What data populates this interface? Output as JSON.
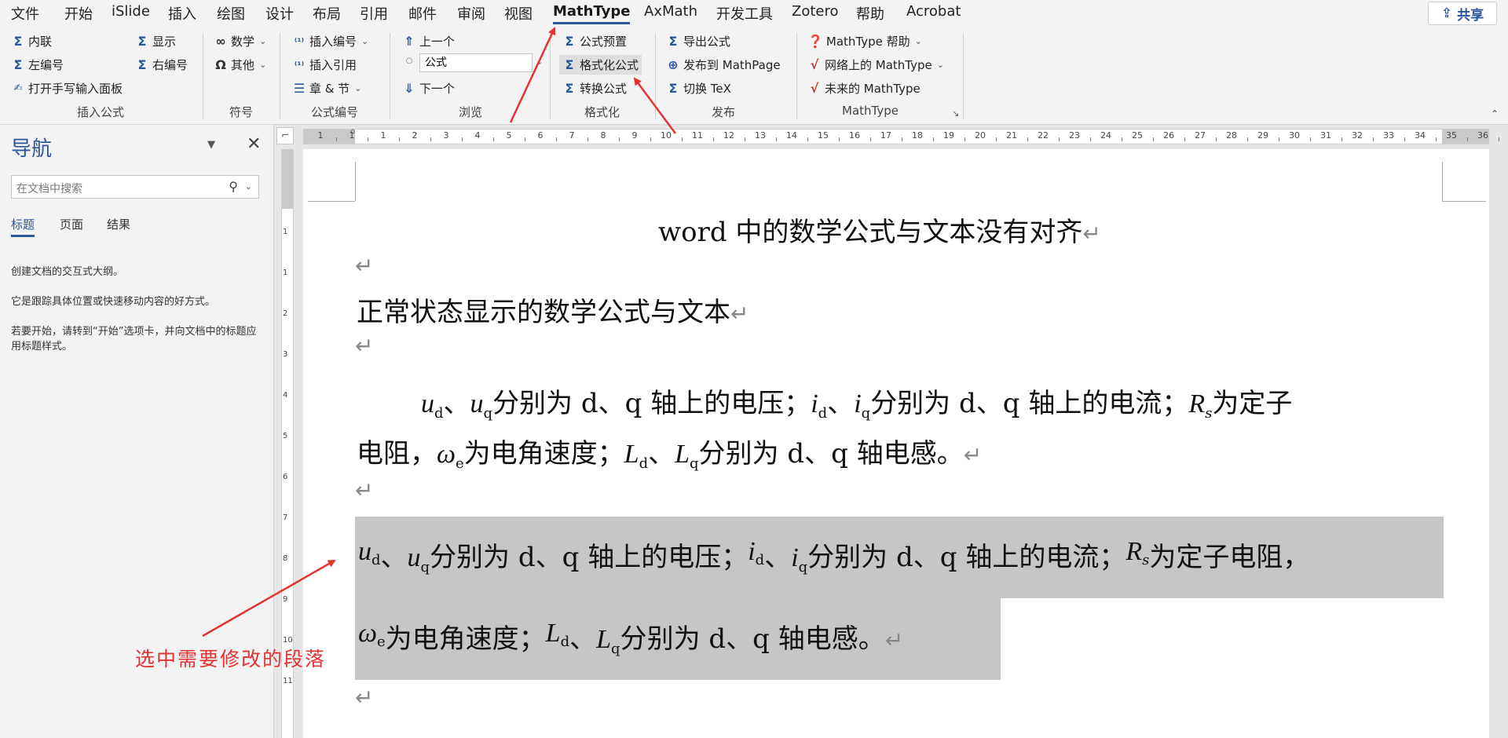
{
  "tabs": [
    "文件",
    "开始",
    "iSlide",
    "插入",
    "绘图",
    "设计",
    "布局",
    "引用",
    "邮件",
    "审阅",
    "视图",
    "MathType",
    "AxMath",
    "开发工具",
    "Zotero",
    "帮助",
    "Acrobat"
  ],
  "active_tab": "MathType",
  "share_label": "共享",
  "ribbon": {
    "insert_formula": {
      "inline": "内联",
      "display": "显示",
      "left_number": "左编号",
      "right_number": "右编号",
      "handwrite": "打开手写输入面板",
      "label": "插入公式"
    },
    "symbols": {
      "math": "数学",
      "other": "其他",
      "label": "符号"
    },
    "numbering": {
      "insert_number": "插入编号",
      "insert_ref": "插入引用",
      "chapter": "章 & 节",
      "label": "公式编号"
    },
    "browse": {
      "prev": "上一个",
      "next": "下一个",
      "field_value": "公式",
      "label": "浏览"
    },
    "format": {
      "preset": "公式预置",
      "format_eq": "格式化公式",
      "convert": "转换公式",
      "label": "格式化"
    },
    "publish": {
      "export": "导出公式",
      "mathpage": "发布到 MathPage",
      "toggle_tex": "切换 TeX",
      "label": "发布"
    },
    "mathtype": {
      "help": "MathType 帮助",
      "online": "网络上的 MathType",
      "future": "未来的 MathType",
      "label": "MathType"
    }
  },
  "nav": {
    "title": "导航",
    "search_placeholder": "在文档中搜索",
    "tabs": [
      "标题",
      "页面",
      "结果"
    ],
    "hint1": "创建文档的交互式大纲。",
    "hint2": "它是跟踪具体位置或快速移动内容的好方式。",
    "hint3": "若要开始，请转到“开始”选项卡，并向文档中的标题应用标题样式。"
  },
  "ruler": {
    "h_numbers": [
      "1",
      "1",
      "1",
      "2",
      "3",
      "4",
      "5",
      "6",
      "7",
      "8",
      "9",
      "10",
      "11",
      "12",
      "13",
      "14",
      "15",
      "16",
      "17",
      "18",
      "19",
      "20",
      "21",
      "22",
      "23",
      "24",
      "25",
      "26",
      "27",
      "28",
      "29",
      "30",
      "31",
      "32",
      "33",
      "34",
      "35",
      "36"
    ],
    "v_numbers": [
      "1",
      "1",
      "2",
      "3",
      "4",
      "5",
      "6",
      "7",
      "8",
      "9",
      "10",
      "11"
    ]
  },
  "document": {
    "title": "word 中的数学公式与文本没有对齐",
    "heading": "正常状态显示的数学公式与文本",
    "para_a": "分别为 d、q 轴上的电压；",
    "para_b": "分别为 d、q 轴上的电流；",
    "para_c": "为定子",
    "para_d": "电阻，",
    "para_e": "为电角速度；",
    "para_f": "分别为 d、q 轴电感。",
    "sel_c": "为定子电阻，",
    "sep": "、",
    "sym_u": "u",
    "sym_i": "i",
    "sym_R": "R",
    "sym_w": "ω",
    "sym_L": "L",
    "sub_d": "d",
    "sub_q": "q",
    "sub_s": "s",
    "sub_e": "e",
    "return_mark": "↵"
  },
  "annotation": "选中需要修改的段落",
  "colors": {
    "accent": "#2b579a",
    "arrow": "#e53333",
    "selection": "#c6c6c6"
  }
}
